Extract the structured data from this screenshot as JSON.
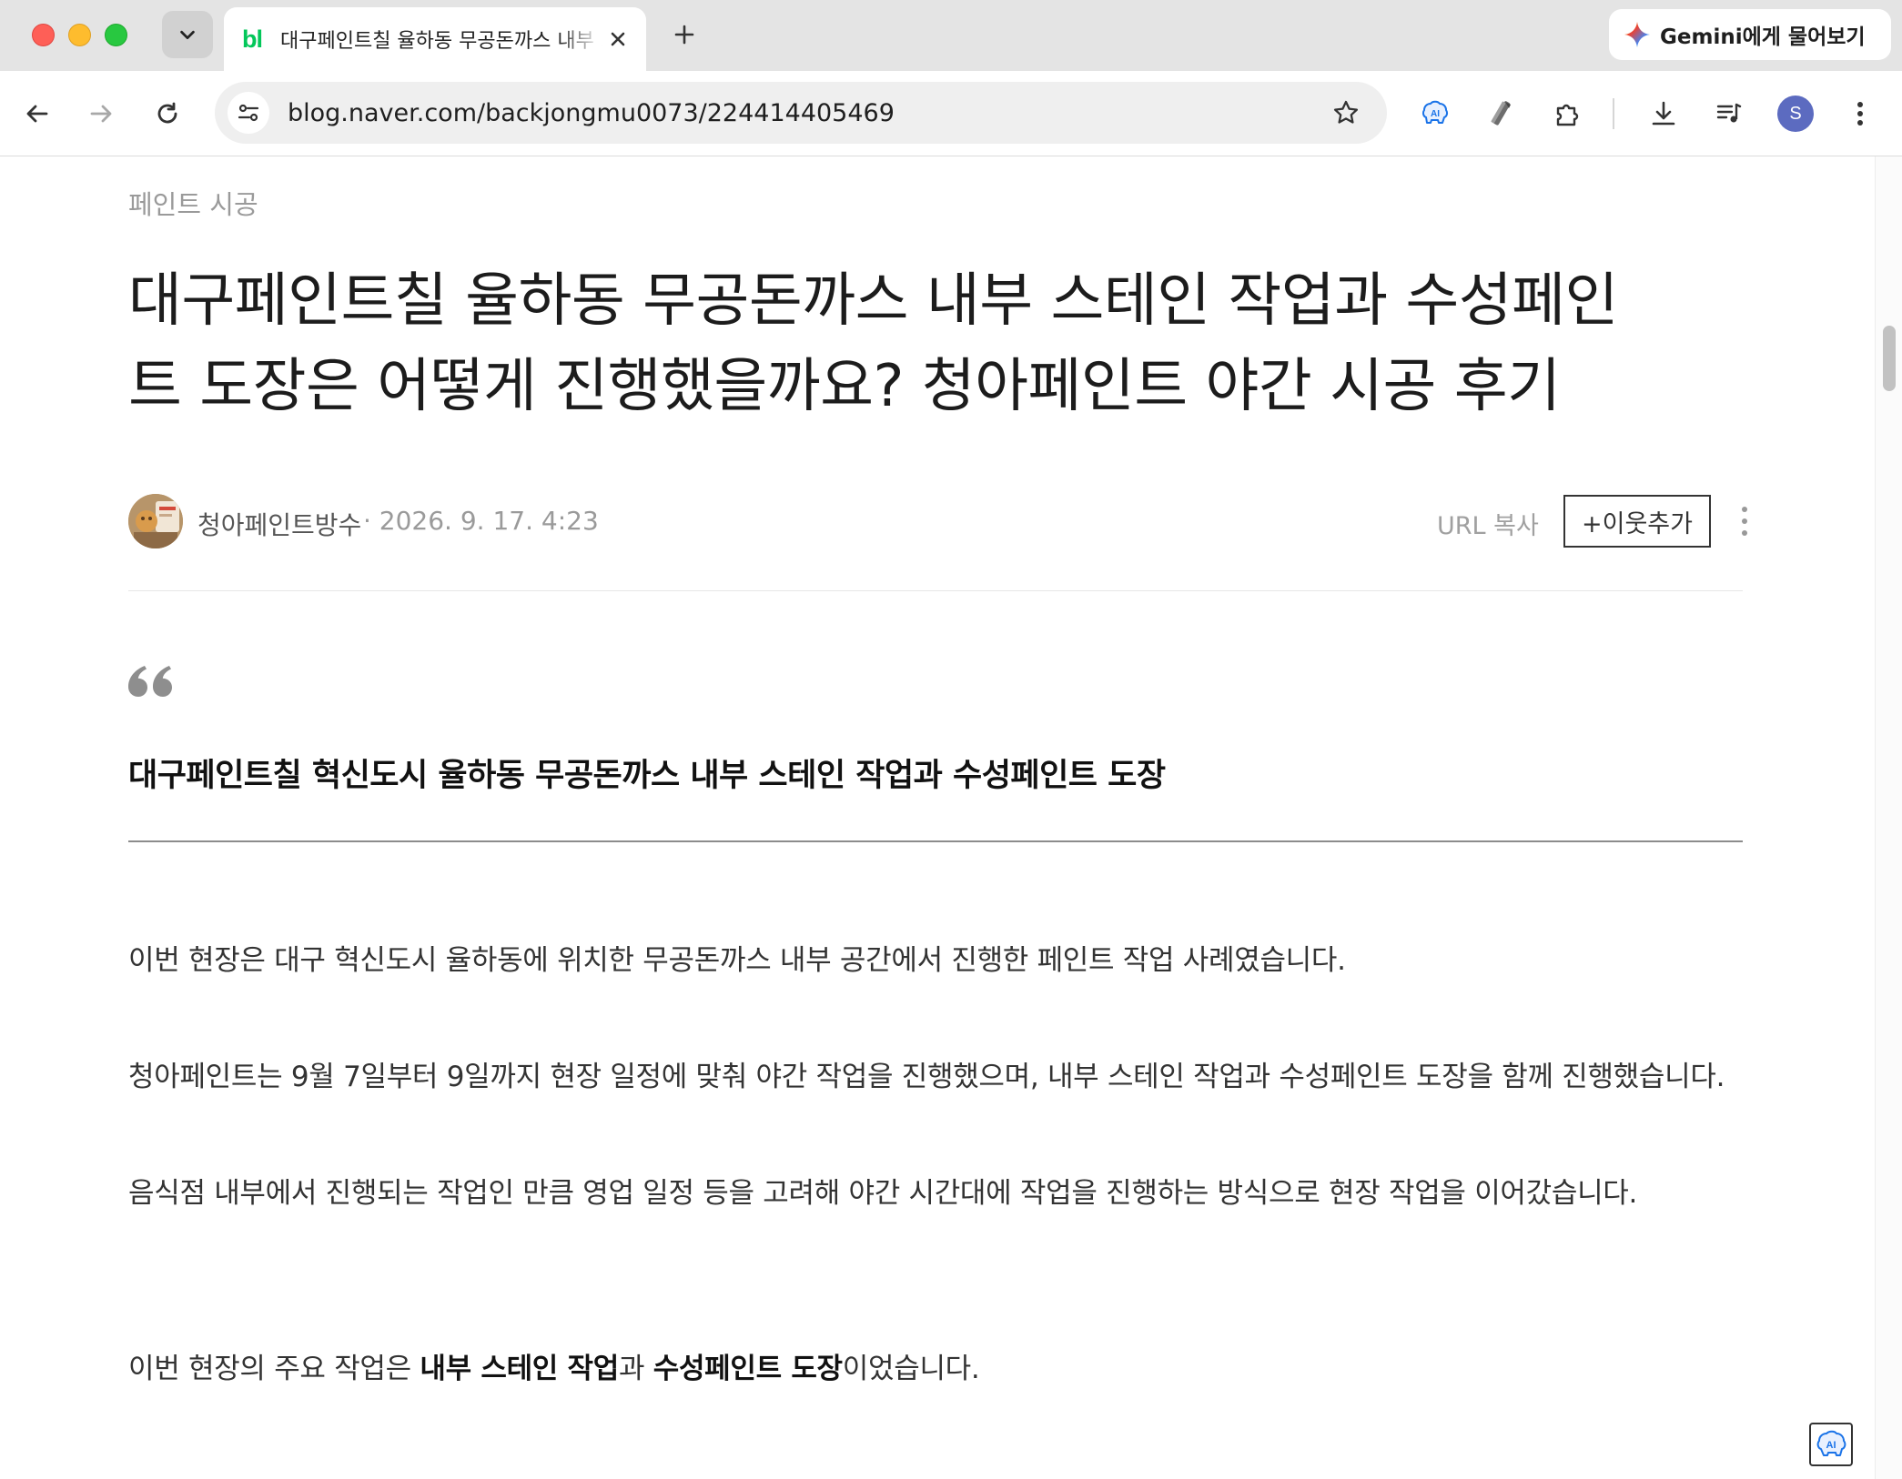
{
  "browser": {
    "tab": {
      "favicon_text": "bl",
      "title": "대구페인트칠 율하동 무공돈까스 내부 스테인 작업과 수성페인트 도장"
    },
    "gemini_label": "Gemini에게 물어보기",
    "address": "blog.naver.com/backjongmu0073/224414405469",
    "profile_initial": "S",
    "icons": {
      "tab_search": "chevron-down-icon",
      "close": "close-icon",
      "new_tab": "plus-icon",
      "gemini": "gemini-sparkle-icon",
      "back": "arrow-left-icon",
      "forward": "arrow-right-icon",
      "reload": "reload-icon",
      "site_info": "tune-icon",
      "bookmark": "star-icon",
      "ai_extension": "ai-brain-icon",
      "tool_extension": "wrench-pen-icon",
      "extensions": "puzzle-icon",
      "download": "download-icon",
      "media": "playlist-music-icon",
      "menu": "kebab-menu-icon"
    }
  },
  "post": {
    "category": "페인트 시공",
    "title_line1": "대구페인트칠 율하동 무공돈까스 내부 스테인 작업과 수성페인",
    "title_line2": "트 도장은 어떻게 진행했을까요? 청아페인트 야간 시공 후기",
    "author": "청아페인트방수",
    "date": "· 2026. 9. 17. 4:23",
    "url_copy": "URL 복사",
    "add_neighbor": "+이웃추가",
    "quote": "대구페인트칠 혁신도시 율하동 무공돈까스 내부 스테인 작업과 수성페인트 도장",
    "paragraphs": [
      "이번 현장은 대구 혁신도시 율하동에 위치한 무공돈까스 내부 공간에서 진행한 페인트 작업 사례였습니다.",
      "청아페인트는 9월 7일부터 9일까지 현장 일정에 맞춰 야간 작업을 진행했으며, 내부 스테인 작업과 수성페인트 도장을 함께 진행했습니다.",
      "음식점 내부에서 진행되는 작업인 만큼 영업 일정 등을 고려해 야간 시간대에 작업을 진행하는 방식으로 현장 작업을 이어갔습니다."
    ],
    "last_para": {
      "p1": "이번 현장의 주요 작업은 ",
      "b1": "내부 스테인 작업",
      "p2": "과 ",
      "b2": "수성페인트 도장",
      "p3": "이었습니다."
    },
    "ai_widget_label": "AI"
  }
}
